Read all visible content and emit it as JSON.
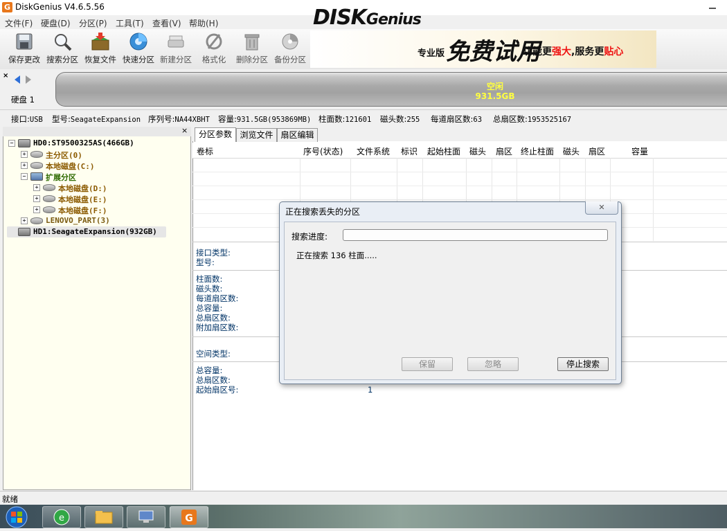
{
  "window": {
    "title": "DiskGenius V4.6.5.56",
    "app_icon": "G"
  },
  "menu": [
    "文件(F)",
    "硬盘(D)",
    "分区(P)",
    "工具(T)",
    "查看(V)",
    "帮助(H)"
  ],
  "toolbar": [
    {
      "label": "保存更改",
      "icon": "save-icon"
    },
    {
      "label": "搜索分区",
      "icon": "magnifier-icon"
    },
    {
      "label": "恢复文件",
      "icon": "restore-box-icon"
    },
    {
      "label": "快速分区",
      "icon": "quick-partition-icon"
    },
    {
      "label": "新建分区",
      "icon": "new-partition-icon"
    },
    {
      "label": "格式化",
      "icon": "format-icon"
    },
    {
      "label": "删除分区",
      "icon": "trash-icon"
    },
    {
      "label": "备份分区",
      "icon": "backup-icon"
    }
  ],
  "banner": {
    "logo_main": "DISK",
    "logo_rest": "Genius",
    "edition": "专业版",
    "free": "免费试用",
    "slogan_a": "功能更",
    "slogan_b": "强大",
    "slogan_c": ",服务更",
    "slogan_d": "贴心"
  },
  "disk_panel": {
    "label": "硬盘 1",
    "free_label": "空闲",
    "free_size": "931.5GB"
  },
  "disk_info": {
    "interface_label": "接口:",
    "interface": "USB",
    "model_label": "型号:",
    "model": "SeagateExpansion",
    "serial_label": "序列号:",
    "serial": "NA44XBHT",
    "capacity_label": "容量:",
    "capacity": "931.5GB(953869MB)",
    "cylinders_label": "柱面数:",
    "cylinders": "121601",
    "heads_label": "磁头数:",
    "heads": "255",
    "spt_label": "每道扇区数:",
    "spt": "63",
    "sectors_label": "总扇区数:",
    "sectors": "1953525167"
  },
  "tree": [
    {
      "label": "HD0:ST9500325AS(466GB)",
      "level": 0,
      "kind": "disk"
    },
    {
      "label": "主分区(0)",
      "level": 1,
      "kind": "primary"
    },
    {
      "label": "本地磁盘(C:)",
      "level": 1,
      "kind": "local"
    },
    {
      "label": "扩展分区",
      "level": 1,
      "kind": "extended"
    },
    {
      "label": "本地磁盘(D:)",
      "level": 2,
      "kind": "local"
    },
    {
      "label": "本地磁盘(E:)",
      "level": 2,
      "kind": "local"
    },
    {
      "label": "本地磁盘(F:)",
      "level": 2,
      "kind": "local"
    },
    {
      "label": "LENOVO_PART(3)",
      "level": 1,
      "kind": "primary"
    },
    {
      "label": "HD1:SeagateExpansion(932GB)",
      "level": 0,
      "kind": "disk",
      "selected": true
    }
  ],
  "tabs": [
    "分区参数",
    "浏览文件",
    "扇区编辑"
  ],
  "columns": [
    "卷标",
    "序号(状态)",
    "文件系统",
    "标识",
    "起始柱面",
    "磁头",
    "扇区",
    "终止柱面",
    "磁头",
    "扇区",
    "容量"
  ],
  "props": {
    "interface_type": "接口类型:",
    "model": "型号:",
    "cylinders": "柱面数:",
    "heads": "磁头数:",
    "spt": "每道扇区数:",
    "total_cap": "总容量:",
    "total_sectors": "总扇区数:",
    "extra_sectors": "附加扇区数:",
    "space_type": "空间类型:",
    "total_cap2": "总容量:",
    "total_sectors2": "总扇区数:",
    "start_sector": "起始扇区号:",
    "start_sector_value": "1"
  },
  "dialog": {
    "title": "正在搜索丢失的分区",
    "progress_label": "搜索进度:",
    "progress": 0,
    "status": "正在搜索 136 柱面.....",
    "btn_keep": "保留",
    "btn_ignore": "忽略",
    "btn_stop": "停止搜索"
  },
  "statusbar": "就绪"
}
